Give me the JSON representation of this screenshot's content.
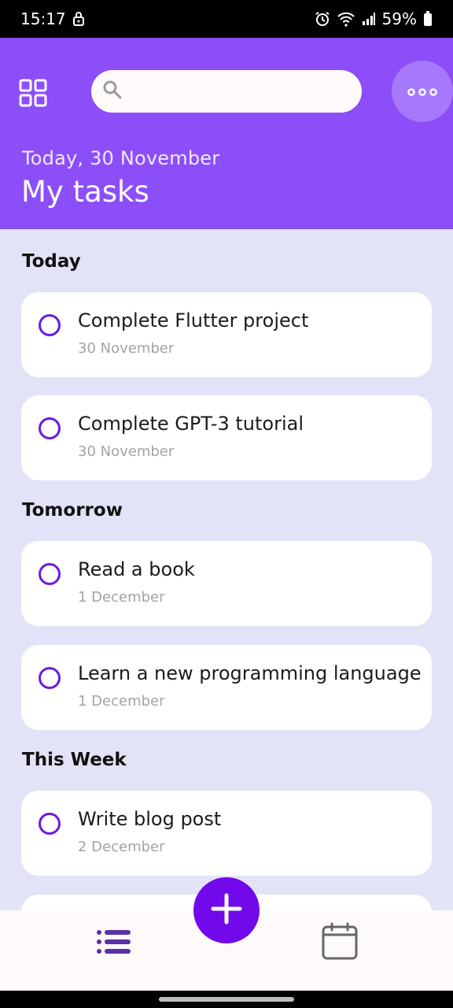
{
  "status_bar": {
    "time": "15:17",
    "battery": "59%",
    "icons": [
      "lock-icon",
      "alarm-icon",
      "wifi-icon",
      "signal-icon",
      "battery-icon"
    ]
  },
  "header": {
    "date": "Today, 30 November",
    "title": "My tasks",
    "search": {
      "value": "",
      "placeholder": ""
    },
    "icons": [
      "grid-icon",
      "search-icon",
      "more-icon"
    ]
  },
  "sections": [
    {
      "title": "Today",
      "tasks": [
        {
          "title": "Complete Flutter project",
          "date": "30 November",
          "done": false
        },
        {
          "title": "Complete GPT-3 tutorial",
          "date": "30 November",
          "done": false
        }
      ]
    },
    {
      "title": "Tomorrow",
      "tasks": [
        {
          "title": "Read a book",
          "date": "1 December",
          "done": false
        },
        {
          "title": "Learn a new programming language",
          "date": "1 December",
          "done": false
        }
      ]
    },
    {
      "title": "This Week",
      "tasks": [
        {
          "title": "Write blog post",
          "date": "2 December",
          "done": false
        }
      ]
    }
  ],
  "bottom_nav": {
    "icons": [
      "list-icon",
      "add-icon",
      "calendar-icon"
    ]
  },
  "colors": {
    "accent": "#8c4ef8",
    "fab": "#7209ea",
    "background": "#e3e3f7",
    "checkbox": "#6a1be0"
  }
}
